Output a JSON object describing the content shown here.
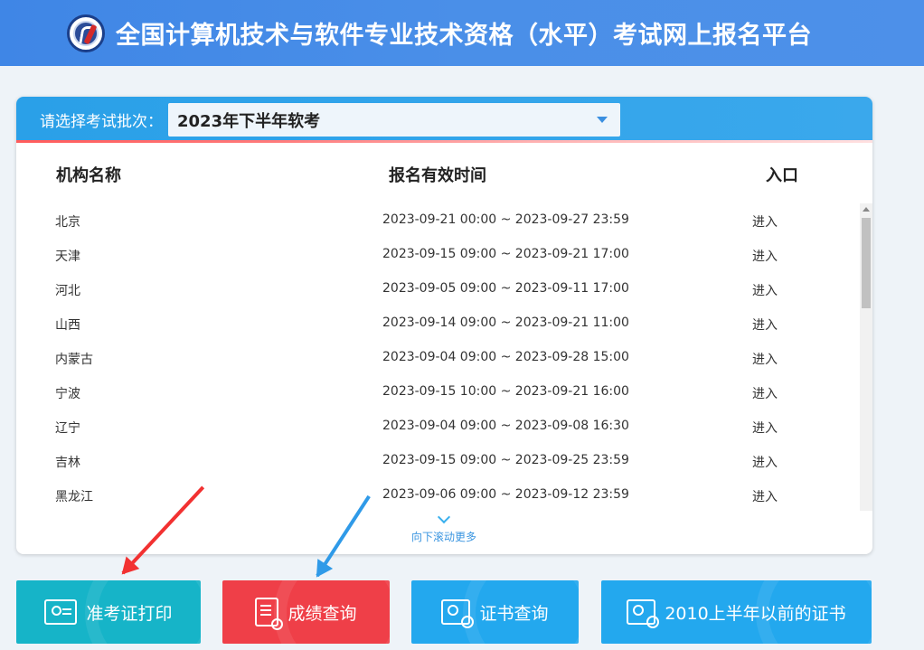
{
  "header": {
    "title": "全国计算机技术与软件专业技术资格（水平）考试网上报名平台",
    "logo_icon": "exam-logo-icon"
  },
  "batch": {
    "label": "请选择考试批次：",
    "selected": "2023年下半年软考"
  },
  "table": {
    "headers": [
      "机构名称",
      "报名有效时间",
      "入口"
    ],
    "rows": [
      {
        "name": "北京",
        "time": "2023-09-21 00:00 ~ 2023-09-27 23:59",
        "entry": "进入"
      },
      {
        "name": "天津",
        "time": "2023-09-15 09:00 ~ 2023-09-21 17:00",
        "entry": "进入"
      },
      {
        "name": "河北",
        "time": "2023-09-05 09:00 ~ 2023-09-11 17:00",
        "entry": "进入"
      },
      {
        "name": "山西",
        "time": "2023-09-14 09:00 ~ 2023-09-21 11:00",
        "entry": "进入"
      },
      {
        "name": "内蒙古",
        "time": "2023-09-04 09:00 ~ 2023-09-28 15:00",
        "entry": "进入"
      },
      {
        "name": "宁波",
        "time": "2023-09-15 10:00 ~ 2023-09-21 16:00",
        "entry": "进入"
      },
      {
        "name": "辽宁",
        "time": "2023-09-04 09:00 ~ 2023-09-08 16:30",
        "entry": "进入"
      },
      {
        "name": "吉林",
        "time": "2023-09-15 09:00 ~ 2023-09-25 23:59",
        "entry": "进入"
      },
      {
        "name": "黑龙江",
        "time": "2023-09-06 09:00 ~ 2023-09-12 23:59",
        "entry": "进入"
      }
    ]
  },
  "scroll_more": "向下滚动更多",
  "buttons": {
    "admit": "准考证打印",
    "score": "成绩查询",
    "cert": "证书查询",
    "old_cert": "2010上半年以前的证书"
  },
  "colors": {
    "header": "#4a8fe8",
    "panel_top": "#2aa0e8",
    "btn_teal": "#16b4c8",
    "btn_red": "#ef3f48",
    "btn_blue": "#23a8ee"
  }
}
